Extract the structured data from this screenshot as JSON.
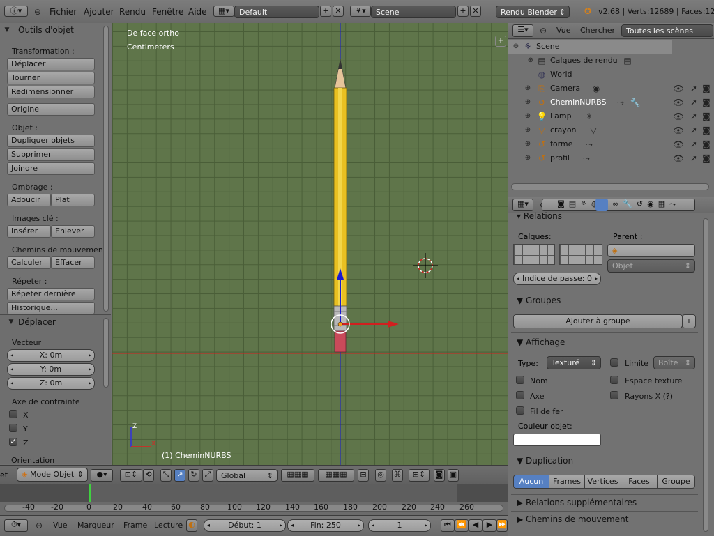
{
  "topbar": {
    "menus": [
      "Fichier",
      "Ajouter",
      "Rendu",
      "Fenêtre",
      "Aide"
    ],
    "screen_layout": "Default",
    "scene": "Scene",
    "render_engine": "Rendu Blender",
    "stats": "v2.68 | Verts:12689 | Faces:12"
  },
  "toolshelf": {
    "title": "Outils d'objet",
    "transformation_label": "Transformation :",
    "deplacer": "Déplacer",
    "tourner": "Tourner",
    "redimensionner": "Redimensionner",
    "origine": "Origine",
    "objet_label": "Objet :",
    "dupliquer": "Dupliquer objets",
    "supprimer": "Supprimer",
    "joindre": "Joindre",
    "ombrage_label": "Ombrage :",
    "adoucir": "Adoucir",
    "plat": "Plat",
    "images_cle_label": "Images clé :",
    "inserer": "Insérer",
    "enlever": "Enlever",
    "chemins_label": "Chemins de mouvemen",
    "calculer": "Calculer",
    "effacer": "Effacer",
    "repeter_label": "Répeter :",
    "repeter_derniere": "Répeter dernière",
    "historique": "Historique..."
  },
  "operator": {
    "title": "Déplacer",
    "vecteur_label": "Vecteur",
    "x": "X: 0m",
    "y": "Y: 0m",
    "z": "Z: 0m",
    "axe_label": "Axe de contrainte",
    "axis_x": "X",
    "axis_y": "Y",
    "axis_z": "Z",
    "axis_checked": "Z",
    "orientation_label": "Orientation"
  },
  "viewport": {
    "view_name": "De face ortho",
    "units": "Centimeters",
    "active_object": "(1) CheminNURBS"
  },
  "viewport_header": {
    "edge_text": "et",
    "mode": "Mode Objet",
    "orientation": "Global"
  },
  "outliner": {
    "menu_vue": "Vue",
    "menu_chercher": "Chercher",
    "filter": "Toutes les scènes",
    "rows": [
      {
        "label": "Scene"
      },
      {
        "label": "Calques de rendu"
      },
      {
        "label": "World"
      },
      {
        "label": "Camera"
      },
      {
        "label": "CheminNURBS"
      },
      {
        "label": "Lamp"
      },
      {
        "label": "crayon"
      },
      {
        "label": "forme"
      },
      {
        "label": "profil"
      }
    ]
  },
  "properties": {
    "relations_title": "Relations",
    "calques_label": "Calques:",
    "parent_label": "Parent :",
    "parent_type": "Objet",
    "indice_passe": "Indice de passe: 0",
    "groupes_title": "Groupes",
    "ajouter_groupe": "Ajouter à groupe",
    "affichage_title": "Affichage",
    "type_label": "Type:",
    "type_value": "Texturé",
    "limite_label": "Limite",
    "limite_value": "Boîte",
    "nom_label": "Nom",
    "espace_texture": "Espace texture",
    "axe_label": "Axe",
    "rayons_x": "Rayons X (?)",
    "fil_de_fer": "Fil de fer",
    "couleur_objet": "Couleur objet:",
    "duplication_title": "Duplication",
    "dup_tabs": [
      "Aucun",
      "Frames",
      "Vertices",
      "Faces",
      "Groupe"
    ],
    "relations_supp": "Relations supplémentaires",
    "chemins_mouvement": "Chemins de mouvement"
  },
  "timeline": {
    "ticks": [
      "-40",
      "-20",
      "0",
      "20",
      "40",
      "60",
      "80",
      "100",
      "120",
      "140",
      "160",
      "180",
      "200",
      "220",
      "240",
      "260"
    ]
  },
  "timeline_header": {
    "vue": "Vue",
    "marqueur": "Marqueur",
    "frame": "Frame",
    "lecture": "Lecture",
    "debut": "Début: 1",
    "fin": "Fin: 250",
    "current": "1"
  },
  "colors": {
    "viewport_bg": "#5f754a",
    "accent_blue": "#5680c2",
    "x_axis": "#d11f1f",
    "z_axis": "#1a1ad0"
  }
}
